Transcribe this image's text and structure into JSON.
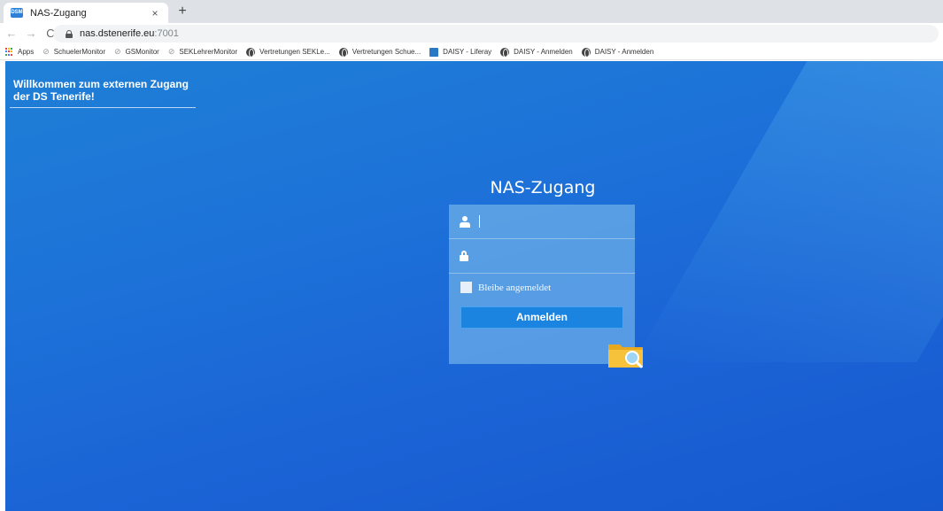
{
  "browser": {
    "tab_title": "NAS-Zugang",
    "tab_close": "×",
    "new_tab": "+",
    "favicon_text": "DSM",
    "back": "←",
    "forward": "→",
    "reload": "C",
    "url_host": "nas.dstenerife.eu",
    "url_port": ":7001"
  },
  "bookmarks": [
    {
      "label": "Apps",
      "icon": "apps-grid-icon"
    },
    {
      "label": "SchuelerMonitor",
      "icon": "link-icon"
    },
    {
      "label": "GSMonitor",
      "icon": "link-icon"
    },
    {
      "label": "SEKLehrerMonitor",
      "icon": "link-icon"
    },
    {
      "label": "Vertretungen SEKLe...",
      "icon": "globe-icon"
    },
    {
      "label": "Vertretungen Schue...",
      "icon": "globe-icon"
    },
    {
      "label": "DAISY - Liferay",
      "icon": "liferay-icon"
    },
    {
      "label": "DAISY - Anmelden",
      "icon": "globe-icon"
    },
    {
      "label": "DAISY - Anmelden",
      "icon": "globe-icon"
    }
  ],
  "page": {
    "welcome": "Willkommen zum externen Zugang der DS Tenerife!",
    "title": "NAS-Zugang",
    "remember_label": "Bleibe angemeldet",
    "login_button": "Anmelden",
    "username_value": "",
    "password_value": ""
  },
  "colors": {
    "background": "#1d6fd7",
    "button": "#1a84e0",
    "folder": "#f2b632"
  }
}
